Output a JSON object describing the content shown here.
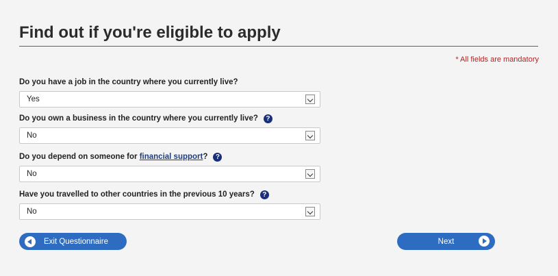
{
  "page": {
    "title": "Find out if you're eligible to apply",
    "mandatory_note": "* All fields are mandatory"
  },
  "questions": [
    {
      "label": "Do you have a job in the country where you currently live?",
      "value": "Yes",
      "has_help": false
    },
    {
      "label": "Do you own a business in the country where you currently live?",
      "value": "No",
      "has_help": true
    },
    {
      "label_before": "Do you depend on someone for ",
      "link": "financial support",
      "label_after": "?",
      "value": "No",
      "has_help": true
    },
    {
      "label": "Have you travelled to other countries in the previous 10 years?",
      "value": "No",
      "has_help": true
    }
  ],
  "buttons": {
    "exit_label": "Exit Questionnaire",
    "next_label": "Next"
  },
  "icons": {
    "help": "question-circle-icon",
    "exit": "arrow-left-circle-icon",
    "next": "arrow-right-circle-icon",
    "dropdown": "chevron-down-icon"
  },
  "colors": {
    "accent": "#2e6cc1",
    "rule": "#c0392b",
    "mandatory": "#b22222",
    "help_icon": "#1a2f7a"
  }
}
